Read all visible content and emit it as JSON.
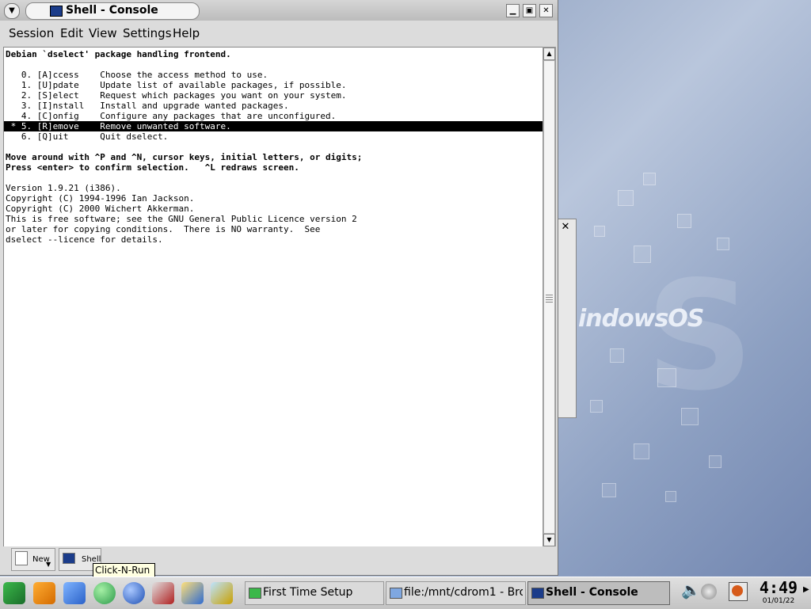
{
  "window": {
    "title": "Shell - Console",
    "menu": [
      "Session",
      "Edit",
      "View",
      "Settings",
      "Help"
    ]
  },
  "terminal": {
    "lines": [
      "Debian `dselect' package handling frontend.",
      "",
      "   0. [A]ccess    Choose the access method to use.",
      "   1. [U]pdate    Update list of available packages, if possible.",
      "   2. [S]elect    Request which packages you want on your system.",
      "   3. [I]nstall   Install and upgrade wanted packages.",
      "   4. [C]onfig    Configure any packages that are unconfigured.",
      " * 5. [R]emove    Remove unwanted software.",
      "   6. [Q]uit      Quit dselect.",
      "",
      "Move around with ^P and ^N, cursor keys, initial letters, or digits;",
      "Press <enter> to confirm selection.   ^L redraws screen.",
      "",
      "Version 1.9.21 (i386).",
      "Copyright (C) 1994-1996 Ian Jackson.",
      "Copyright (C) 2000 Wichert Akkerman.",
      "This is free software; see the GNU General Public Licence version 2",
      "or later for copying conditions.  There is NO warranty.  See",
      "dselect --licence for details."
    ]
  },
  "session_tabs": {
    "new_label": "New",
    "shell_label": "Shell"
  },
  "tooltip": "Click-N-Run",
  "desktop": {
    "logo": "indowsOS"
  },
  "taskbar": {
    "tasks": [
      "First Time Setup",
      "file:/mnt/cdrom1 - Brow",
      "Shell - Console"
    ],
    "clock_time": "4:49",
    "clock_date": "01/01/22"
  }
}
